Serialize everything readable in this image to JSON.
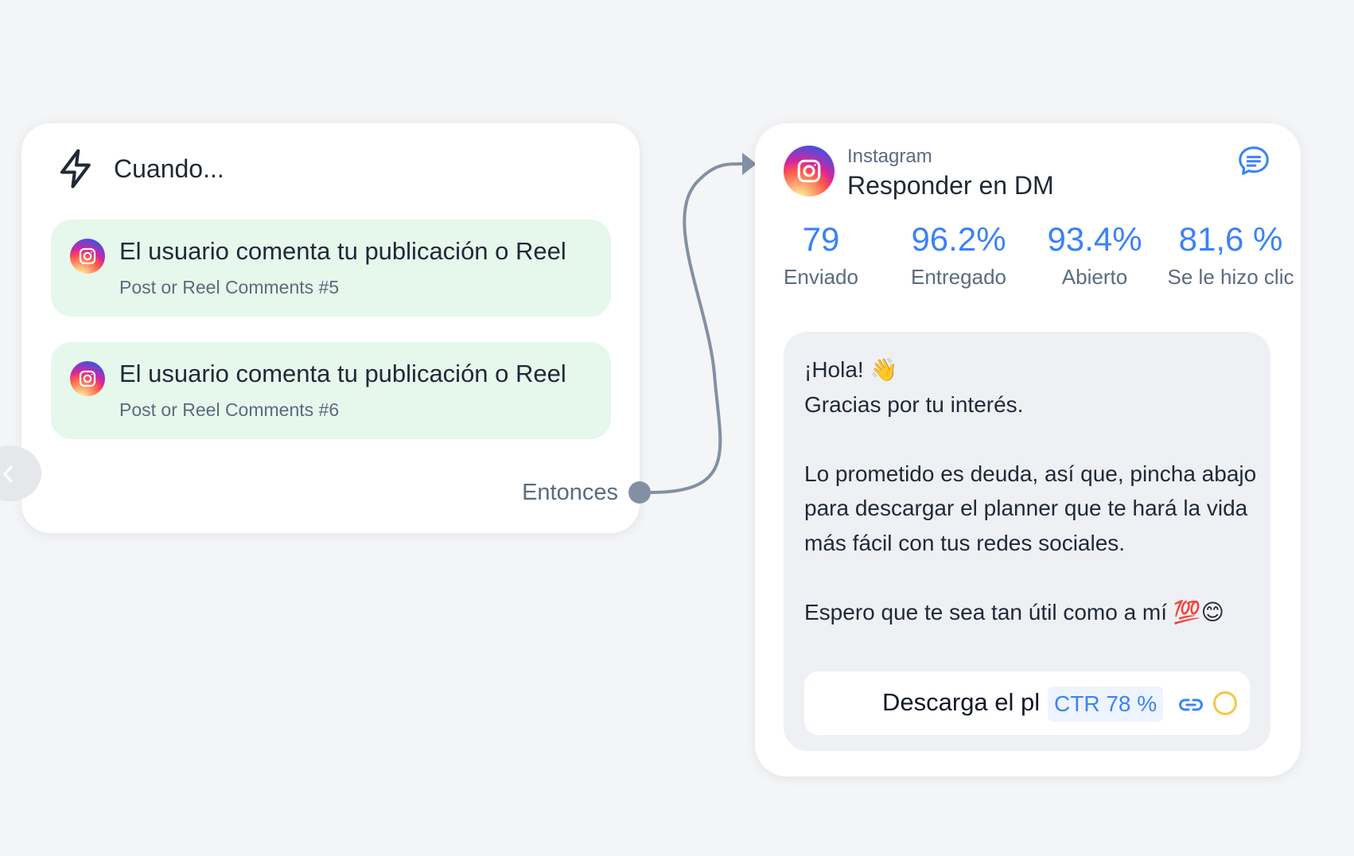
{
  "trigger": {
    "title": "Cuando...",
    "icon": "lightning-bolt-icon",
    "items": [
      {
        "title": "El usuario comenta tu publicación o Reel",
        "subtitle": "Post or Reel Comments #5",
        "icon": "instagram-icon"
      },
      {
        "title": "El usuario comenta tu publicación o Reel",
        "subtitle": "Post or Reel Comments #6",
        "icon": "instagram-icon"
      }
    ],
    "then_label": "Entonces"
  },
  "action": {
    "platform": "Instagram",
    "title": "Responder en DM",
    "stats": [
      {
        "value": "79",
        "label": "Enviado"
      },
      {
        "value": "96.2%",
        "label": "Entregado"
      },
      {
        "value": "93.4%",
        "label": "Abierto"
      },
      {
        "value": "81,6 %",
        "label": "Se le hizo clic"
      }
    ],
    "message": "¡Hola! 👋\nGracias por tu interés.\n\nLo prometido es deuda, así que, pincha abajo para descargar el planner que te hará la vida más fácil con tus redes sociales.\n\nEspero que te sea tan útil como a mí 💯😊",
    "button": {
      "label": "Descarga el pl",
      "ctr": "CTR 78 %"
    }
  },
  "colors": {
    "accent": "#3b82f6",
    "trigger_item_bg": "#e6f7ec",
    "connector": "#8390a4",
    "message_bg": "#eef0f4"
  }
}
